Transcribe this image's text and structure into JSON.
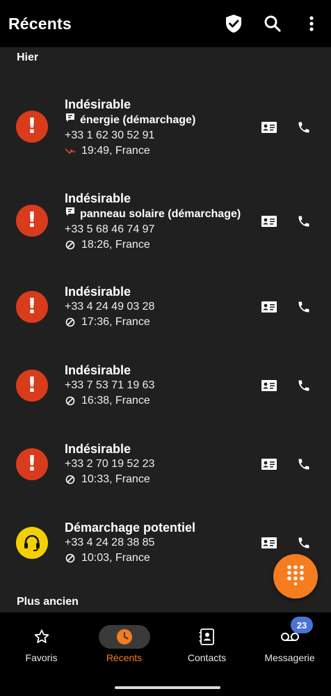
{
  "header": {
    "title": "Récents",
    "icons": [
      "shield-check-icon",
      "search-icon",
      "more-vert-icon"
    ]
  },
  "sections": {
    "yesterday": "Hier",
    "older": "Plus ancien"
  },
  "calls": [
    {
      "name": "Indésirable",
      "tag": "énergie (démarchage)",
      "number": "+33 1 62 30 52 91",
      "meta": "19:49, France",
      "status_icon": "missed-call-icon",
      "avatar": "warning-icon",
      "avatar_color": "#d93b1d"
    },
    {
      "name": "Indésirable",
      "tag": "panneau solaire (démarchage)",
      "number": "+33 5 68 46 74 97",
      "meta": "18:26, France",
      "status_icon": "blocked-icon",
      "avatar": "warning-icon",
      "avatar_color": "#d93b1d"
    },
    {
      "name": "Indésirable",
      "tag": "",
      "number": "+33 4 24 49 03 28",
      "meta": "17:36, France",
      "status_icon": "blocked-icon",
      "avatar": "warning-icon",
      "avatar_color": "#d93b1d"
    },
    {
      "name": "Indésirable",
      "tag": "",
      "number": "+33 7 53 71 19 63",
      "meta": "16:38, France",
      "status_icon": "blocked-icon",
      "avatar": "warning-icon",
      "avatar_color": "#d93b1d"
    },
    {
      "name": "Indésirable",
      "tag": "",
      "number": "+33 2 70 19 52 23",
      "meta": "10:33, France",
      "status_icon": "blocked-icon",
      "avatar": "warning-icon",
      "avatar_color": "#d93b1d"
    },
    {
      "name": "Démarchage potentiel",
      "tag": "",
      "number": "+33 4 24 28 38 85",
      "meta": "10:03, France",
      "status_icon": "blocked-icon",
      "avatar": "headset-icon",
      "avatar_color": "#f4d000"
    }
  ],
  "nav": [
    {
      "label": "Favoris",
      "icon": "star-icon",
      "active": false
    },
    {
      "label": "Récents",
      "icon": "clock-icon",
      "active": true
    },
    {
      "label": "Contacts",
      "icon": "contacts-icon",
      "active": false
    },
    {
      "label": "Messagerie",
      "icon": "voicemail-icon",
      "active": false
    }
  ],
  "voicemail_badge": "23",
  "colors": {
    "accent": "#f57c1f",
    "spam_red": "#d93b1d",
    "potential_yellow": "#f4d000",
    "badge_blue": "#4a73d8",
    "background": "#202020"
  }
}
